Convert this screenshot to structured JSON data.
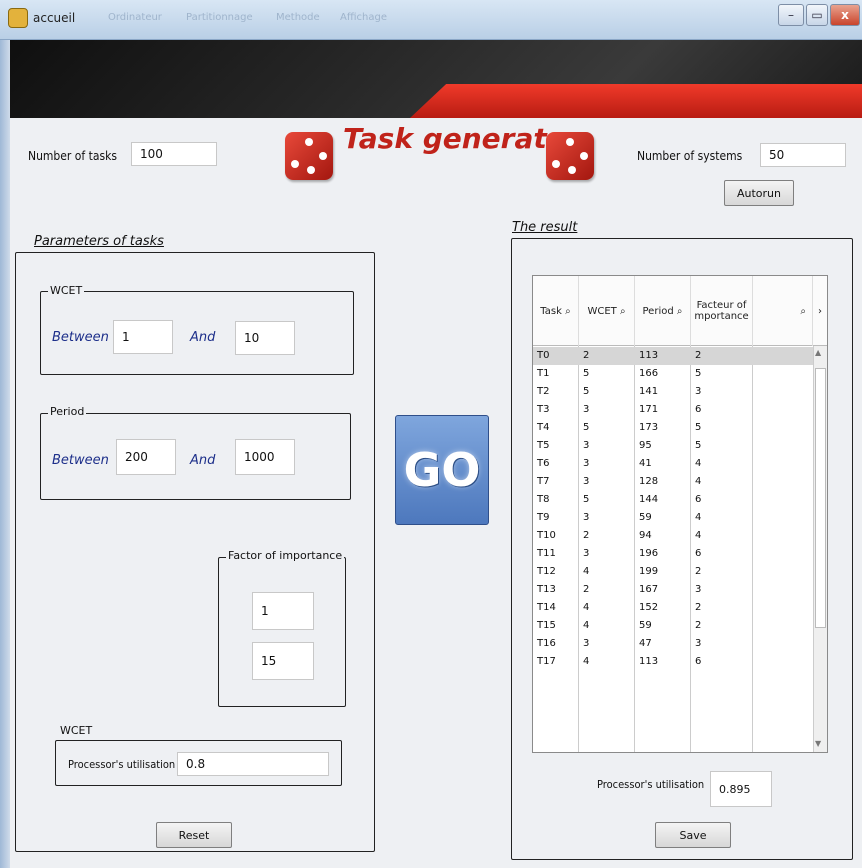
{
  "window": {
    "title": "accueil",
    "faint_tabs": [
      "Ordinateur",
      "Partitionnage",
      "Methode",
      "Affichage"
    ]
  },
  "header": {
    "title": "Task generator"
  },
  "top": {
    "num_tasks_label": "Number of tasks",
    "num_tasks_value": "100",
    "num_systems_label": "Number of systems",
    "num_systems_value": "50",
    "autorun_label": "Autorun"
  },
  "params": {
    "title": "Parameters of tasks",
    "wcet": {
      "title": "WCET",
      "between": "Between",
      "and": "And",
      "min": "1",
      "max": "10"
    },
    "period": {
      "title": "Period",
      "between": "Between",
      "and": "And",
      "min": "200",
      "max": "1000"
    },
    "factor": {
      "title": "Factor of importance",
      "min": "1",
      "max": "15"
    },
    "util": {
      "title": "WCET",
      "label": "Processor's utilisation",
      "value": "0.8"
    },
    "reset_label": "Reset"
  },
  "go_label": "GO",
  "result": {
    "title": "The result",
    "headers": [
      "Task",
      "WCET",
      "Period",
      "Facteur of mportance"
    ],
    "rows": [
      [
        "T0",
        "2",
        "113",
        "2"
      ],
      [
        "T1",
        "5",
        "166",
        "5"
      ],
      [
        "T2",
        "5",
        "141",
        "3"
      ],
      [
        "T3",
        "3",
        "171",
        "6"
      ],
      [
        "T4",
        "5",
        "173",
        "5"
      ],
      [
        "T5",
        "3",
        "95",
        "5"
      ],
      [
        "T6",
        "3",
        "41",
        "4"
      ],
      [
        "T7",
        "3",
        "128",
        "4"
      ],
      [
        "T8",
        "5",
        "144",
        "6"
      ],
      [
        "T9",
        "3",
        "59",
        "4"
      ],
      [
        "T10",
        "2",
        "94",
        "4"
      ],
      [
        "T11",
        "3",
        "196",
        "6"
      ],
      [
        "T12",
        "4",
        "199",
        "2"
      ],
      [
        "T13",
        "2",
        "167",
        "3"
      ],
      [
        "T14",
        "4",
        "152",
        "2"
      ],
      [
        "T15",
        "4",
        "59",
        "2"
      ],
      [
        "T16",
        "3",
        "47",
        "3"
      ],
      [
        "T17",
        "4",
        "113",
        "6"
      ]
    ],
    "util_label": "Processor's utilisation",
    "util_value": "0.895",
    "save_label": "Save"
  },
  "colors": {
    "accent_red": "#c0231a",
    "go_blue": "#5a83c6",
    "banner_dark": "#1a1a1a"
  },
  "icons": [
    "dice-icon",
    "app-icon",
    "minimize-icon",
    "maximize-icon",
    "close-icon",
    "sort-icon",
    "search-icon"
  ]
}
